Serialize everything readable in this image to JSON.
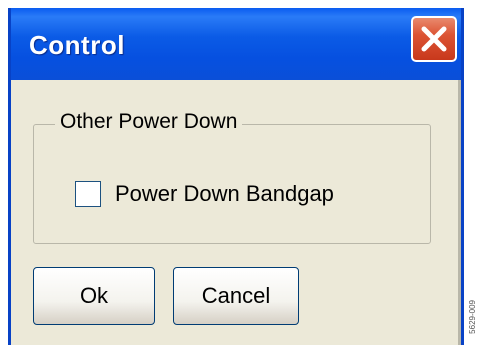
{
  "window": {
    "title": "Control",
    "close_icon": "close-x-icon"
  },
  "group": {
    "legend": "Other Power Down",
    "checkbox": {
      "label": "Power Down Bandgap",
      "checked": false
    }
  },
  "buttons": {
    "ok_label": "Ok",
    "cancel_label": "Cancel"
  },
  "figure_id": "5629-009",
  "colors": {
    "titlebar": "#0a5ae6",
    "dialog_background": "#ece9d8",
    "close_button": "#dc5434"
  }
}
